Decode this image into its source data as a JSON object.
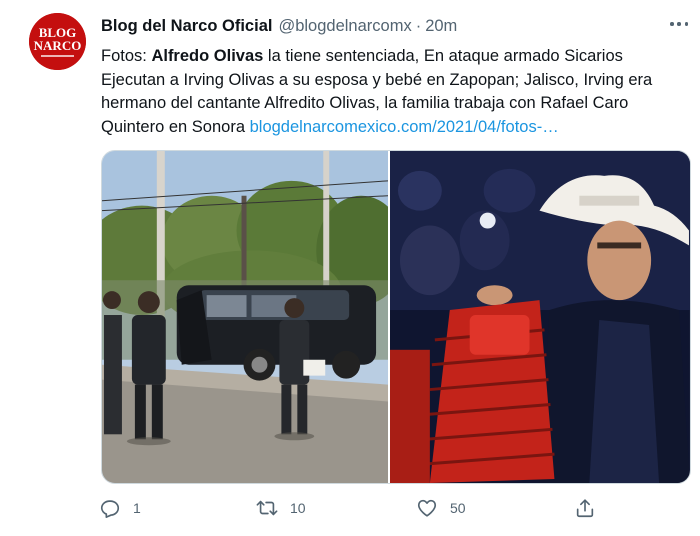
{
  "tweet": {
    "author": {
      "name": "Blog del Narco Oficial",
      "handle": "@blogdelnarcomx",
      "separator": "·",
      "time": "20m",
      "avatar_text_top": "BLOG",
      "avatar_text_bottom": "NARCO"
    },
    "body": {
      "prefix": "Fotos: ",
      "bold": "Alfredo Olivas",
      "main": " la tiene sentenciada, En ataque armado Sicarios Ejecutan a Irving Olivas a su esposa y bebé en Zapopan; Jalisco, Irving era hermano del cantante Alfredito Olivas, la familia trabaja con Rafael Caro Quintero en Sonora ",
      "link": "blogdelnarcomexico.com/2021/04/fotos-…"
    },
    "media": [
      {
        "description_icon": "photo-crime-scene"
      },
      {
        "description_icon": "photo-singer-accordion"
      }
    ],
    "actions": {
      "reply_count": "1",
      "retweet_count": "10",
      "like_count": "50"
    }
  },
  "colors": {
    "text": "#0f1419",
    "secondary": "#536471",
    "link": "#1b95e0",
    "avatar": "#c40f0f"
  },
  "icons": {
    "more": "more-icon",
    "reply": "reply-icon",
    "retweet": "retweet-icon",
    "like": "like-icon",
    "share": "share-icon"
  }
}
